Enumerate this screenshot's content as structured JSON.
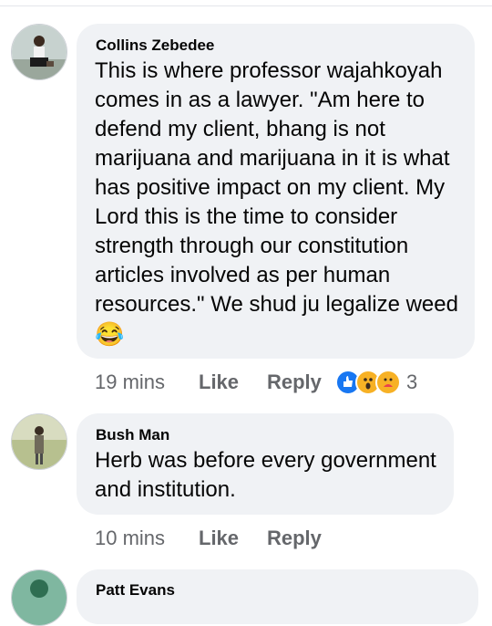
{
  "comments": [
    {
      "author": "Collins Zebedee",
      "text": "This is where professor wajahkoyah comes in as a lawyer. \"Am here to defend my client, bhang is not marijuana and marijuana in it is what has positive impact on my client. My Lord this is the time to consider strength through our constitution articles involved as per human resources.\" We shud ju legalize weed",
      "emoji": "😂",
      "time": "19 mins",
      "like_label": "Like",
      "reply_label": "Reply",
      "reaction_icons": [
        "like-reaction-icon",
        "wow-reaction-icon",
        "care-reaction-icon"
      ],
      "reaction_count": "3"
    },
    {
      "author": "Bush Man",
      "text": "Herb was before every government and institution.",
      "time": "10 mins",
      "like_label": "Like",
      "reply_label": "Reply"
    },
    {
      "author": "Patt Evans"
    }
  ],
  "colors": {
    "bubble": "#f0f2f5",
    "meta_text": "#65676b",
    "like_blue": "#1877f2",
    "wow_yellow": "#f7b125"
  }
}
